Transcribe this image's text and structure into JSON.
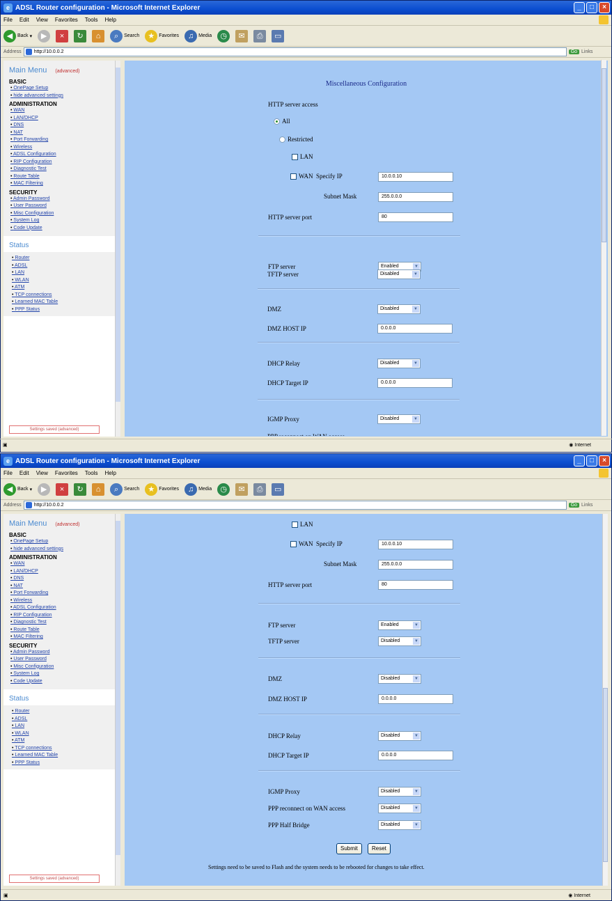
{
  "window": {
    "title": "ADSL Router configuration - Microsoft Internet Explorer",
    "address_label": "Address",
    "address": "http://10.0.0.2",
    "go": "Go",
    "links": "Links"
  },
  "menu": [
    "File",
    "Edit",
    "View",
    "Favorites",
    "Tools",
    "Help"
  ],
  "toolbar": {
    "back": "Back",
    "search": "Search",
    "favorites": "Favorites",
    "media": "Media"
  },
  "statusbar": {
    "zone": "Internet"
  },
  "sidebar": {
    "title": "Main Menu",
    "title_tag": "(advanced)",
    "basic_label": "BASIC",
    "basic": [
      "OnePage Setup",
      "hide advanced settings"
    ],
    "admin_label": "ADMINISTRATION",
    "admin": [
      "WAN",
      "LAN/DHCP",
      "DNS",
      "NAT",
      "Port Forwarding",
      "Wireless",
      "ADSL Configuration",
      "RIP Configuration",
      "Diagnostic Test",
      "Route Table",
      "MAC Filtering"
    ],
    "security_label": "SECURITY",
    "security": [
      "Admin Password",
      "User Password",
      "Misc Configuration",
      "System Log",
      "Code Update"
    ],
    "status_label": "Status",
    "status": [
      "Router",
      "ADSL",
      "LAN",
      "WLAN",
      "ATM",
      "TCP connections",
      "Learned MAC Table",
      "PPP Status"
    ],
    "footer": "Settings saved (advanced)"
  },
  "page": {
    "title": "Miscellaneous Configuration",
    "http_access_label": "HTTP server access",
    "all_label": "All",
    "restricted_label": "Restricted",
    "lan_label": "LAN",
    "wan_label": "WAN",
    "specify_ip_label": "Specify IP",
    "specify_ip": "10.0.0.10",
    "subnet_label": "Subnet Mask",
    "subnet": "255.0.0.0",
    "http_port_label": "HTTP server port",
    "http_port": "80",
    "ftp_label": "FTP server",
    "ftp": "Enabled",
    "tftp_label": "TFTP server",
    "tftp": "Disabled",
    "dmz_label": "DMZ",
    "dmz": "Disabled",
    "dmz_host_label": "DMZ HOST IP",
    "dmz_host": "0.0.0.0",
    "dhcp_relay_label": "DHCP Relay",
    "dhcp_relay": "Disabled",
    "dhcp_target_label": "DHCP Target IP",
    "dhcp_target": "0.0.0.0",
    "igmp_label": "IGMP Proxy",
    "igmp": "Disabled",
    "ppp_reconnect_label": "PPP reconnect on WAN access",
    "ppp_reconnect": "Disabled",
    "ppp_half_label": "PPP Half Bridge",
    "ppp_half": "Disabled",
    "submit": "Submit",
    "reset": "Reset",
    "note": "Settings need to be saved to Flash and the system needs to be rebooted for changes to take effect."
  }
}
